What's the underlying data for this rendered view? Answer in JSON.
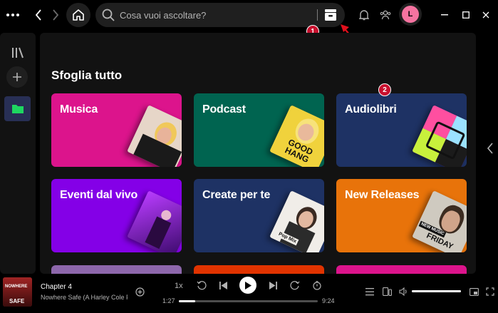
{
  "search": {
    "placeholder": "Cosa vuoi ascoltare?"
  },
  "user": {
    "initial": "L"
  },
  "main": {
    "title": "Sfoglia tutto",
    "cards": [
      {
        "label": "Musica",
        "color": "#dc148c"
      },
      {
        "label": "Podcast",
        "color": "#006450"
      },
      {
        "label": "Audiolibri",
        "color": "#1e3264"
      },
      {
        "label": "Eventi dal vivo",
        "color": "#8400e7"
      },
      {
        "label": "Create per te",
        "color": "#1e3264"
      },
      {
        "label": "New Releases",
        "color": "#e8730a"
      }
    ],
    "covers": {
      "podcast": "GOOD HANG",
      "create": "Pop Mix",
      "releases_top": "NEW MUSIC",
      "releases_bottom": "FRIDAY"
    }
  },
  "player": {
    "track_title": "Chapter 4",
    "track_subtitle": "Nowhere Safe (A Harley Cole F",
    "art_text_top": "NOWHERE",
    "art_text_bottom": "SAFE",
    "speed": "1x",
    "elapsed": "1:27",
    "remaining": "9:24",
    "progress": 0.12,
    "volume": 1.0
  },
  "annotations": {
    "badge_1": "1",
    "badge_2": "2"
  },
  "icons": {
    "topbar": [
      "more-icon",
      "back-icon",
      "forward-icon",
      "home-icon",
      "search-icon",
      "browse-icon",
      "bell-icon",
      "friends-icon",
      "minimize-icon",
      "maximize-icon",
      "close-icon"
    ],
    "sidebar": [
      "library-icon",
      "plus-icon",
      "folder-icon"
    ]
  },
  "colors": {
    "accent": "#1ed760",
    "badge": "#c8102e",
    "avatar": "#f573a0",
    "folder_bg": "#282f55"
  }
}
